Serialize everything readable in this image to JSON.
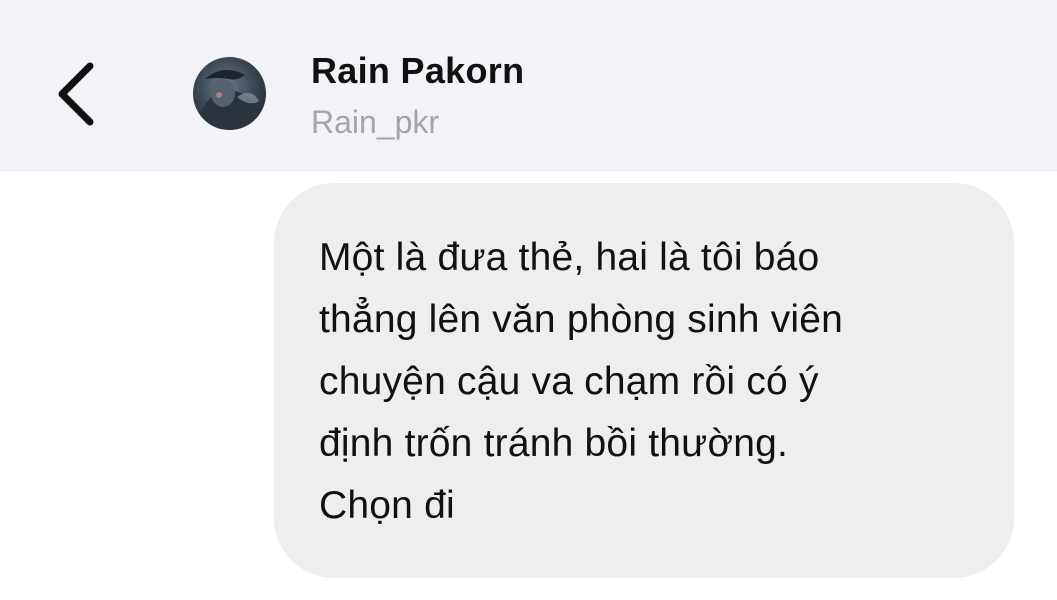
{
  "header": {
    "contact_name": "Rain Pakorn",
    "contact_handle": "Rain_pkr",
    "back_icon": "chevron-left-icon"
  },
  "conversation": {
    "messages": [
      {
        "text": "Một là đưa thẻ, hai là tôi báo\nthẳng lên văn phòng sinh viên\nchuyện cậu va chạm rồi có ý\nđịnh trốn tránh bồi thường.\nChọn đi"
      }
    ]
  },
  "colors": {
    "header_bg": "#f2f2f7",
    "bubble_bg": "#eeeef0",
    "handle_text": "#a4a4aa"
  }
}
